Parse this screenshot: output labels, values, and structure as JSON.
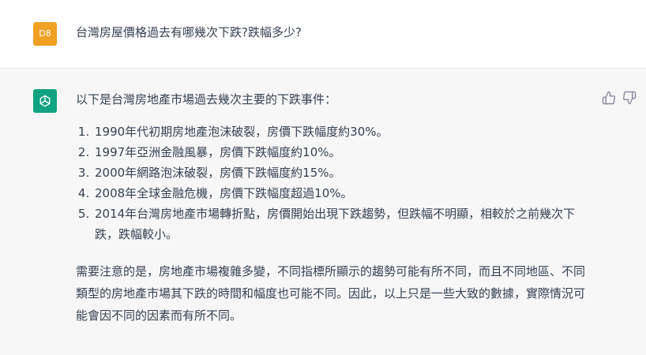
{
  "user": {
    "avatar_initials": "D8",
    "message": "台灣房屋價格過去有哪幾次下跌?跌幅多少?"
  },
  "assistant": {
    "intro": "以下是台灣房地產市場過去幾次主要的下跌事件：",
    "items": [
      "1990年代初期房地產泡沫破裂，房價下跌幅度約30%。",
      "1997年亞洲金融風暴，房價下跌幅度約10%。",
      "2000年網路泡沫破裂，房價下跌幅度約15%。",
      "2008年全球金融危機，房價下跌幅度超過10%。",
      "2014年台灣房地產市場轉折點，房價開始出現下跌趨勢，但跌幅不明顯，相較於之前幾次下跌，跌幅較小。"
    ],
    "note": "需要注意的是，房地產市場複雜多變，不同指標所顯示的趨勢可能有所不同，而且不同地區、不同類型的房地產市場其下跌的時間和幅度也可能不同。因此，以上只是一些大致的數據，實際情況可能會因不同的因素而有所不同。"
  },
  "colors": {
    "user_avatar": "#f0a023",
    "bot_avatar": "#10a37f",
    "assistant_bg": "#f7f7f8"
  },
  "icons": [
    "openai-logo-icon",
    "thumbs-up-icon",
    "thumbs-down-icon"
  ]
}
